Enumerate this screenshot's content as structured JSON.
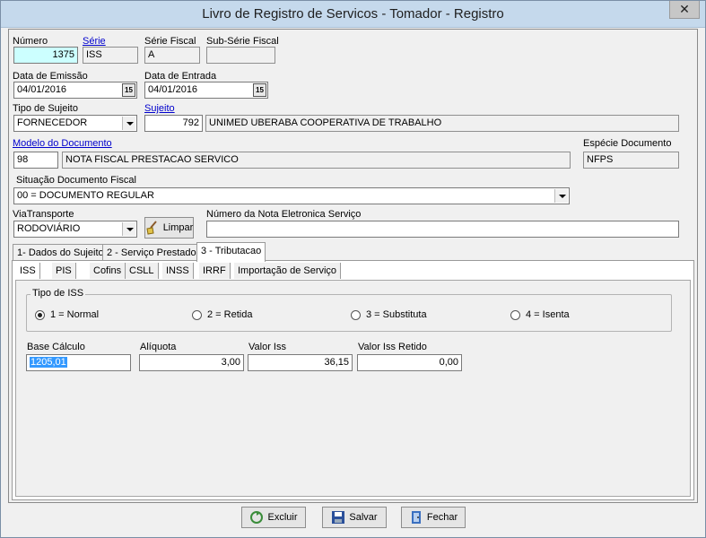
{
  "window": {
    "title": "Livro de Registro de Servicos - Tomador - Registro",
    "close_label": "✕"
  },
  "fields": {
    "numero": {
      "label": "Número",
      "value": "1375"
    },
    "serie": {
      "label": "Série",
      "value": "ISS"
    },
    "serie_fiscal": {
      "label": "Série Fiscal",
      "value": "A"
    },
    "sub_serie_fiscal": {
      "label": "Sub-Série Fiscal",
      "value": ""
    },
    "data_emissao": {
      "label": "Data de Emissão",
      "value": "04/01/2016",
      "cal_label": "15"
    },
    "data_entrada": {
      "label": "Data de Entrada",
      "value": "04/01/2016",
      "cal_label": "15"
    },
    "tipo_sujeito": {
      "label": "Tipo de Sujeito",
      "value": "FORNECEDOR"
    },
    "sujeito": {
      "label": "Sujeito",
      "code": "792",
      "name": "UNIMED UBERABA COOPERATIVA DE TRABALHO"
    },
    "modelo_documento": {
      "label": "Modelo do Documento",
      "code": "98",
      "name": "NOTA FISCAL PRESTACAO SERVICO"
    },
    "especie_documento": {
      "label": "Espécie Documento",
      "value": "NFPS"
    },
    "situacao_documento": {
      "label": "Situação Documento Fiscal",
      "value": "00 = DOCUMENTO REGULAR"
    },
    "via_transporte": {
      "label": "ViaTransporte",
      "value": "RODOVIÁRIO"
    },
    "limpar_label": "Limpar",
    "numero_nota_eletronica": {
      "label": "Número da Nota Eletronica Serviço",
      "value": ""
    }
  },
  "tabs": [
    {
      "label": "1- Dados do Sujeito"
    },
    {
      "label": "2 - Serviço Prestado"
    },
    {
      "label": "3 - Tributacao"
    }
  ],
  "subtabs": [
    {
      "label": "ISS"
    },
    {
      "label": "PIS"
    },
    {
      "label": "Cofins"
    },
    {
      "label": "CSLL"
    },
    {
      "label": "INSS"
    },
    {
      "label": "IRRF"
    },
    {
      "label": "Importação de Serviço"
    }
  ],
  "iss": {
    "tipo_title": "Tipo de ISS",
    "options": [
      {
        "label": "1 = Normal",
        "selected": true
      },
      {
        "label": "2 = Retida",
        "selected": false
      },
      {
        "label": "3 = Substituta",
        "selected": false
      },
      {
        "label": "4 = Isenta",
        "selected": false
      }
    ],
    "base_calculo": {
      "label": "Base Cálculo",
      "value": "1205,01"
    },
    "aliquota": {
      "label": "Alíquota",
      "value": "3,00"
    },
    "valor_iss": {
      "label": "Valor Iss",
      "value": "36,15"
    },
    "valor_iss_retido": {
      "label": "Valor Iss Retido",
      "value": "0,00"
    }
  },
  "buttons": {
    "excluir": "Excluir",
    "salvar": "Salvar",
    "fechar": "Fechar"
  },
  "colors": {
    "titlebar": "#c5d9ec",
    "highlight_input": "#ccffff",
    "link": "#0000cc",
    "selection": "#3399ff"
  }
}
